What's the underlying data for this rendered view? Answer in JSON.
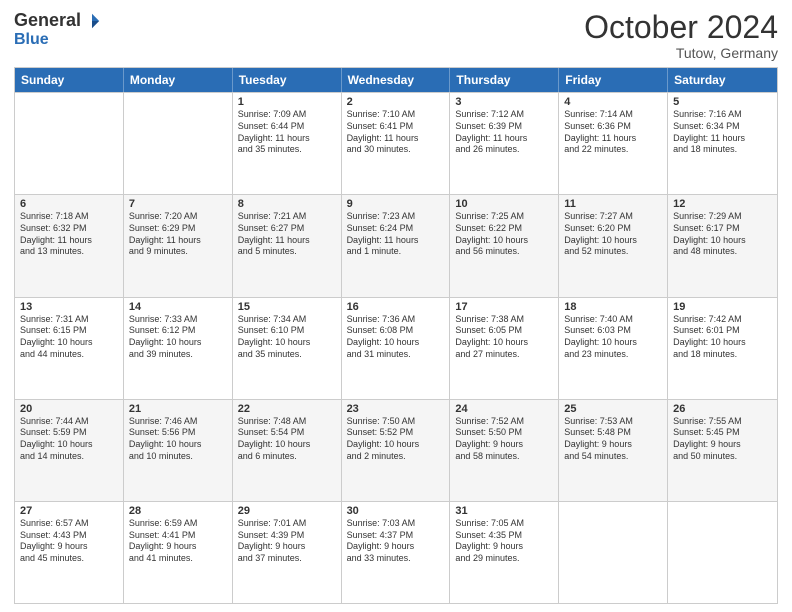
{
  "logo": {
    "general": "General",
    "blue": "Blue"
  },
  "header": {
    "month": "October 2024",
    "location": "Tutow, Germany"
  },
  "days": [
    "Sunday",
    "Monday",
    "Tuesday",
    "Wednesday",
    "Thursday",
    "Friday",
    "Saturday"
  ],
  "rows": [
    [
      {
        "num": "",
        "lines": []
      },
      {
        "num": "",
        "lines": []
      },
      {
        "num": "1",
        "lines": [
          "Sunrise: 7:09 AM",
          "Sunset: 6:44 PM",
          "Daylight: 11 hours",
          "and 35 minutes."
        ]
      },
      {
        "num": "2",
        "lines": [
          "Sunrise: 7:10 AM",
          "Sunset: 6:41 PM",
          "Daylight: 11 hours",
          "and 30 minutes."
        ]
      },
      {
        "num": "3",
        "lines": [
          "Sunrise: 7:12 AM",
          "Sunset: 6:39 PM",
          "Daylight: 11 hours",
          "and 26 minutes."
        ]
      },
      {
        "num": "4",
        "lines": [
          "Sunrise: 7:14 AM",
          "Sunset: 6:36 PM",
          "Daylight: 11 hours",
          "and 22 minutes."
        ]
      },
      {
        "num": "5",
        "lines": [
          "Sunrise: 7:16 AM",
          "Sunset: 6:34 PM",
          "Daylight: 11 hours",
          "and 18 minutes."
        ]
      }
    ],
    [
      {
        "num": "6",
        "lines": [
          "Sunrise: 7:18 AM",
          "Sunset: 6:32 PM",
          "Daylight: 11 hours",
          "and 13 minutes."
        ]
      },
      {
        "num": "7",
        "lines": [
          "Sunrise: 7:20 AM",
          "Sunset: 6:29 PM",
          "Daylight: 11 hours",
          "and 9 minutes."
        ]
      },
      {
        "num": "8",
        "lines": [
          "Sunrise: 7:21 AM",
          "Sunset: 6:27 PM",
          "Daylight: 11 hours",
          "and 5 minutes."
        ]
      },
      {
        "num": "9",
        "lines": [
          "Sunrise: 7:23 AM",
          "Sunset: 6:24 PM",
          "Daylight: 11 hours",
          "and 1 minute."
        ]
      },
      {
        "num": "10",
        "lines": [
          "Sunrise: 7:25 AM",
          "Sunset: 6:22 PM",
          "Daylight: 10 hours",
          "and 56 minutes."
        ]
      },
      {
        "num": "11",
        "lines": [
          "Sunrise: 7:27 AM",
          "Sunset: 6:20 PM",
          "Daylight: 10 hours",
          "and 52 minutes."
        ]
      },
      {
        "num": "12",
        "lines": [
          "Sunrise: 7:29 AM",
          "Sunset: 6:17 PM",
          "Daylight: 10 hours",
          "and 48 minutes."
        ]
      }
    ],
    [
      {
        "num": "13",
        "lines": [
          "Sunrise: 7:31 AM",
          "Sunset: 6:15 PM",
          "Daylight: 10 hours",
          "and 44 minutes."
        ]
      },
      {
        "num": "14",
        "lines": [
          "Sunrise: 7:33 AM",
          "Sunset: 6:12 PM",
          "Daylight: 10 hours",
          "and 39 minutes."
        ]
      },
      {
        "num": "15",
        "lines": [
          "Sunrise: 7:34 AM",
          "Sunset: 6:10 PM",
          "Daylight: 10 hours",
          "and 35 minutes."
        ]
      },
      {
        "num": "16",
        "lines": [
          "Sunrise: 7:36 AM",
          "Sunset: 6:08 PM",
          "Daylight: 10 hours",
          "and 31 minutes."
        ]
      },
      {
        "num": "17",
        "lines": [
          "Sunrise: 7:38 AM",
          "Sunset: 6:05 PM",
          "Daylight: 10 hours",
          "and 27 minutes."
        ]
      },
      {
        "num": "18",
        "lines": [
          "Sunrise: 7:40 AM",
          "Sunset: 6:03 PM",
          "Daylight: 10 hours",
          "and 23 minutes."
        ]
      },
      {
        "num": "19",
        "lines": [
          "Sunrise: 7:42 AM",
          "Sunset: 6:01 PM",
          "Daylight: 10 hours",
          "and 18 minutes."
        ]
      }
    ],
    [
      {
        "num": "20",
        "lines": [
          "Sunrise: 7:44 AM",
          "Sunset: 5:59 PM",
          "Daylight: 10 hours",
          "and 14 minutes."
        ]
      },
      {
        "num": "21",
        "lines": [
          "Sunrise: 7:46 AM",
          "Sunset: 5:56 PM",
          "Daylight: 10 hours",
          "and 10 minutes."
        ]
      },
      {
        "num": "22",
        "lines": [
          "Sunrise: 7:48 AM",
          "Sunset: 5:54 PM",
          "Daylight: 10 hours",
          "and 6 minutes."
        ]
      },
      {
        "num": "23",
        "lines": [
          "Sunrise: 7:50 AM",
          "Sunset: 5:52 PM",
          "Daylight: 10 hours",
          "and 2 minutes."
        ]
      },
      {
        "num": "24",
        "lines": [
          "Sunrise: 7:52 AM",
          "Sunset: 5:50 PM",
          "Daylight: 9 hours",
          "and 58 minutes."
        ]
      },
      {
        "num": "25",
        "lines": [
          "Sunrise: 7:53 AM",
          "Sunset: 5:48 PM",
          "Daylight: 9 hours",
          "and 54 minutes."
        ]
      },
      {
        "num": "26",
        "lines": [
          "Sunrise: 7:55 AM",
          "Sunset: 5:45 PM",
          "Daylight: 9 hours",
          "and 50 minutes."
        ]
      }
    ],
    [
      {
        "num": "27",
        "lines": [
          "Sunrise: 6:57 AM",
          "Sunset: 4:43 PM",
          "Daylight: 9 hours",
          "and 45 minutes."
        ]
      },
      {
        "num": "28",
        "lines": [
          "Sunrise: 6:59 AM",
          "Sunset: 4:41 PM",
          "Daylight: 9 hours",
          "and 41 minutes."
        ]
      },
      {
        "num": "29",
        "lines": [
          "Sunrise: 7:01 AM",
          "Sunset: 4:39 PM",
          "Daylight: 9 hours",
          "and 37 minutes."
        ]
      },
      {
        "num": "30",
        "lines": [
          "Sunrise: 7:03 AM",
          "Sunset: 4:37 PM",
          "Daylight: 9 hours",
          "and 33 minutes."
        ]
      },
      {
        "num": "31",
        "lines": [
          "Sunrise: 7:05 AM",
          "Sunset: 4:35 PM",
          "Daylight: 9 hours",
          "and 29 minutes."
        ]
      },
      {
        "num": "",
        "lines": []
      },
      {
        "num": "",
        "lines": []
      }
    ]
  ],
  "row_alt": [
    false,
    true,
    false,
    true,
    false
  ]
}
